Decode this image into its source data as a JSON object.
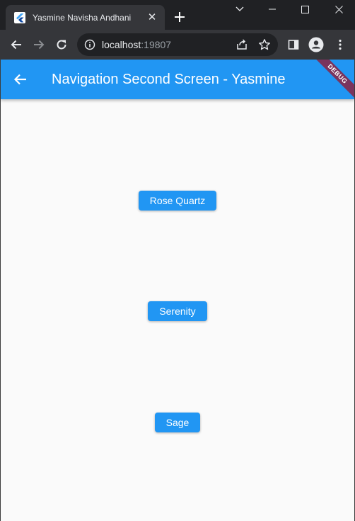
{
  "browser": {
    "tab": {
      "title": "Yasmine Navisha Andhani",
      "close_glyph": "✕",
      "favicon": "flutter-icon"
    },
    "address_bar": {
      "host": "localhost",
      "port": ":19807"
    },
    "icons": [
      "back-icon",
      "forward-icon",
      "reload-icon",
      "info-icon",
      "share-icon",
      "star-icon",
      "side-panel-icon",
      "profile-icon",
      "more-icon"
    ]
  },
  "app": {
    "appbar": {
      "title": "Navigation Second Screen - Yasmine",
      "back_icon": "arrow-back-icon",
      "color": "#2196f3"
    },
    "debug_banner": "DEBUG",
    "buttons": [
      {
        "label": "Rose Quartz"
      },
      {
        "label": "Serenity"
      },
      {
        "label": "Sage"
      }
    ]
  },
  "colors": {
    "accent": "#2196f3",
    "background": "#fafafa",
    "chrome_dark": "#202124",
    "chrome_toolbar": "#35363a"
  }
}
